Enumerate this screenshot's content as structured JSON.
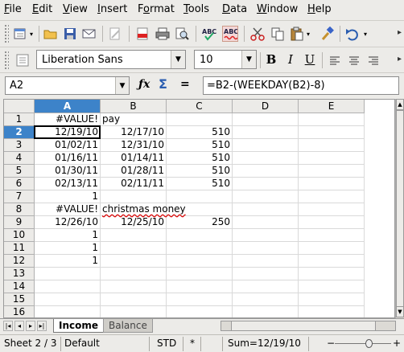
{
  "menu": [
    "File",
    "Edit",
    "View",
    "Insert",
    "Format",
    "Tools",
    "Data",
    "Window",
    "Help"
  ],
  "menu_access": [
    "F",
    "E",
    "V",
    "I",
    "o",
    "T",
    "D",
    "W",
    "H"
  ],
  "toolbar": {
    "icons": [
      "new-document-icon",
      "open-folder-icon",
      "save-icon",
      "email-icon",
      "edit-file-icon",
      "export-pdf-icon",
      "print-icon",
      "print-preview-icon",
      "spellcheck-icon",
      "autospellcheck-icon",
      "cut-icon",
      "copy-icon",
      "paste-icon",
      "format-paintbrush-icon",
      "undo-icon"
    ],
    "font_name": "Liberation Sans",
    "font_size": "10",
    "bold": "B",
    "italic": "I",
    "underline": "U"
  },
  "formula_bar": {
    "cell_ref": "A2",
    "formula": "=B2-(WEEKDAY(B2)-8)"
  },
  "columns": [
    "A",
    "B",
    "C",
    "D",
    "E"
  ],
  "selected_column": "A",
  "selected_row": 2,
  "rows": [
    {
      "n": "1",
      "a": "#VALUE!",
      "b": "pay",
      "c": ""
    },
    {
      "n": "2",
      "a": "12/19/10",
      "b": "12/17/10",
      "c": "510"
    },
    {
      "n": "3",
      "a": "01/02/11",
      "b": "12/31/10",
      "c": "510"
    },
    {
      "n": "4",
      "a": "01/16/11",
      "b": "01/14/11",
      "c": "510"
    },
    {
      "n": "5",
      "a": "01/30/11",
      "b": "01/28/11",
      "c": "510"
    },
    {
      "n": "6",
      "a": "02/13/11",
      "b": "02/11/11",
      "c": "510"
    },
    {
      "n": "7",
      "a": "1",
      "b": "",
      "c": ""
    },
    {
      "n": "8",
      "a": "#VALUE!",
      "b": "christmas money",
      "c": ""
    },
    {
      "n": "9",
      "a": "12/26/10",
      "b": "12/25/10",
      "c": "250"
    },
    {
      "n": "10",
      "a": "1",
      "b": "",
      "c": ""
    },
    {
      "n": "11",
      "a": "1",
      "b": "",
      "c": ""
    },
    {
      "n": "12",
      "a": "1",
      "b": "",
      "c": ""
    },
    {
      "n": "13",
      "a": "",
      "b": "",
      "c": ""
    },
    {
      "n": "14",
      "a": "",
      "b": "",
      "c": ""
    },
    {
      "n": "15",
      "a": "",
      "b": "",
      "c": ""
    },
    {
      "n": "16",
      "a": "",
      "b": "",
      "c": ""
    }
  ],
  "sheet_tabs": [
    {
      "label": "Income",
      "active": true
    },
    {
      "label": "Balance",
      "active": false
    }
  ],
  "status": {
    "sheet": "Sheet 2 / 3",
    "style": "Default",
    "mode": "STD",
    "modified": "*",
    "sum": "Sum=12/19/10"
  }
}
